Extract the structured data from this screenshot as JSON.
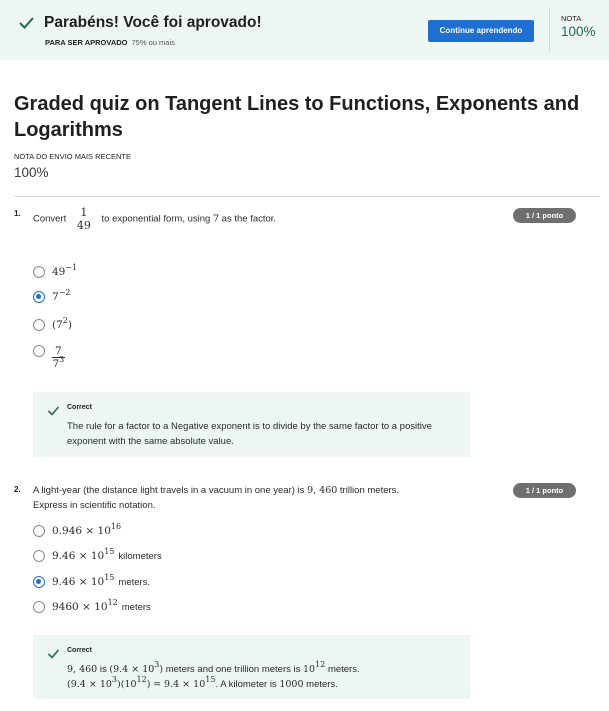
{
  "banner": {
    "title": "Parabéns! Você foi aprovado!",
    "pass_label": "PARA SER APROVADO",
    "pass_value": "75% ou mais",
    "continue_label": "Continue aprendendo",
    "grade_label": "NOTA",
    "grade_value": "100%"
  },
  "header": {
    "title": "Graded quiz on Tangent Lines to Functions, Exponents and Logarithms",
    "recent_label": "NOTA DO ENVIO MAIS RECENTE",
    "recent_value": "100%"
  },
  "q1": {
    "number": "1.",
    "prompt_pre": "Convert",
    "frac_num": "1",
    "frac_den": "49",
    "prompt_post": "to exponential form, using",
    "prompt_var": "7",
    "prompt_end": "as the factor.",
    "score": "1 / 1 ponto",
    "options": [
      {
        "base": "49",
        "exp": "−1",
        "selected": false
      },
      {
        "base": "7",
        "exp": "−2",
        "selected": true
      },
      {
        "base": "(7",
        "exp": "2",
        "tail": ")",
        "selected": false
      },
      {
        "num": "7",
        "den_base": "7",
        "den_exp": "3",
        "selected": false
      }
    ],
    "feedback_label": "Correct",
    "feedback_text": "The rule for a factor to a Negative exponent is to divide by the same factor to a positive exponent with the same absolute value."
  },
  "q2": {
    "number": "2.",
    "prompt_a": "A light-year (the distance light travels in a vacuum in one year) is",
    "prompt_value": "9, 460",
    "prompt_b": "trillion meters.",
    "prompt_c": "Express in scientific notation.",
    "score": "1 / 1 ponto",
    "options": [
      {
        "mant": "0.946 × 10",
        "exp": "16",
        "unit": "",
        "selected": false
      },
      {
        "mant": "9.46 × 10",
        "exp": "15",
        "unit": "kilometers",
        "selected": false
      },
      {
        "mant": "9.46 × 10",
        "exp": "15",
        "unit": "meters.",
        "selected": true
      },
      {
        "mant": "9460 × 10",
        "exp": "12",
        "unit": "meters",
        "selected": false
      }
    ],
    "feedback_label": "Correct",
    "fb_l1_a": "9, 460",
    "fb_l1_b": "is",
    "fb_l1_c": "(9.4 × 10",
    "fb_l1_c_exp": "3",
    "fb_l1_d": ")",
    "fb_l1_e": "meters and one trillion meters is",
    "fb_l1_f": "10",
    "fb_l1_f_exp": "12",
    "fb_l1_g": "meters.",
    "fb_l2_a": "(9.4 × 10",
    "fb_l2_a_exp": "3",
    "fb_l2_b": ")(10",
    "fb_l2_b_exp": "12",
    "fb_l2_c": ")",
    "fb_l2_d": "= 9.4 × 10",
    "fb_l2_d_exp": "15",
    "fb_l2_e": ". A kilometer is",
    "fb_l2_f": "1000",
    "fb_l2_g": "meters."
  },
  "colors": {
    "accent": "#1f6fd1",
    "success": "#1f6b4a",
    "banner_bg": "#eef6f3",
    "pill": "#6f6f6f"
  }
}
